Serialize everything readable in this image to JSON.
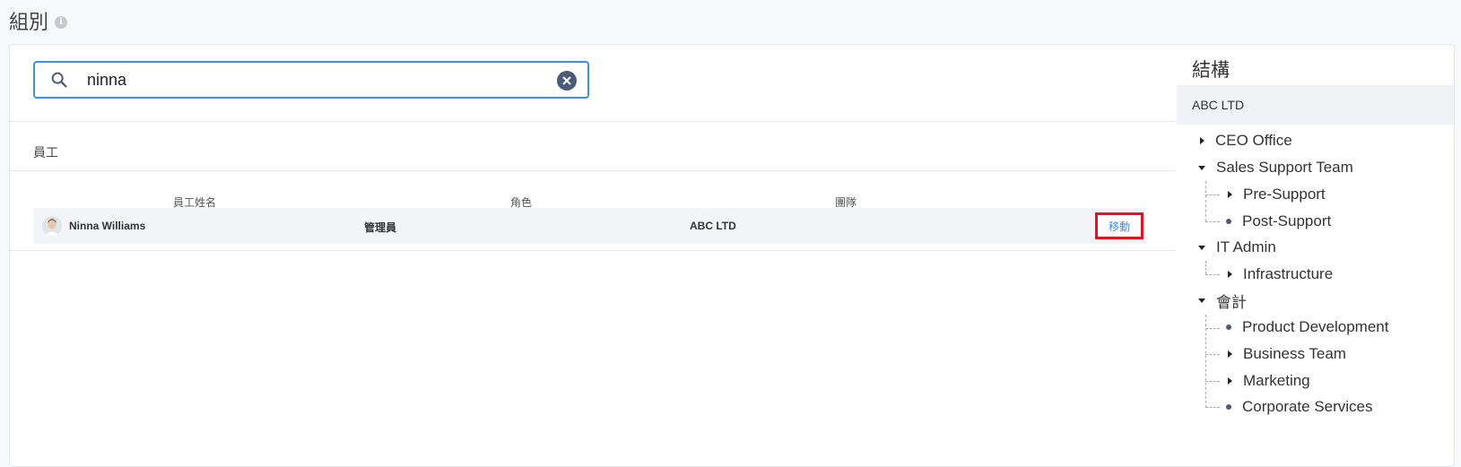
{
  "page": {
    "title": "組別",
    "info_icon": "info-icon"
  },
  "search": {
    "value": "ninna",
    "placeholder": ""
  },
  "employees_section": {
    "label": "員工",
    "columns": [
      "員工姓名",
      "角色",
      "團隊"
    ],
    "rows": [
      {
        "name": "Ninna Williams",
        "role": "管理員",
        "team": "ABC LTD",
        "action": "移動"
      }
    ]
  },
  "structure": {
    "title": "結構",
    "root": "ABC LTD",
    "nodes": [
      {
        "label": "CEO Office",
        "state": "collapsed",
        "level": 1
      },
      {
        "label": "Sales Support Team",
        "state": "expanded",
        "level": 1
      },
      {
        "label": "Pre-Support",
        "state": "collapsed",
        "level": 2
      },
      {
        "label": "Post-Support",
        "state": "leaf",
        "level": 2
      },
      {
        "label": "IT Admin",
        "state": "expanded",
        "level": 1
      },
      {
        "label": "Infrastructure",
        "state": "collapsed",
        "level": 2
      },
      {
        "label": "會計",
        "state": "expanded",
        "level": 1
      },
      {
        "label": "Product Development",
        "state": "leaf",
        "level": 2
      },
      {
        "label": "Business Team",
        "state": "collapsed",
        "level": 2
      },
      {
        "label": "Marketing",
        "state": "collapsed",
        "level": 2
      },
      {
        "label": "Corporate Services",
        "state": "leaf",
        "level": 2
      }
    ]
  },
  "colors": {
    "accent": "#3d8ee6",
    "highlight": "#e3141f",
    "bullet": "#4a5c78"
  }
}
